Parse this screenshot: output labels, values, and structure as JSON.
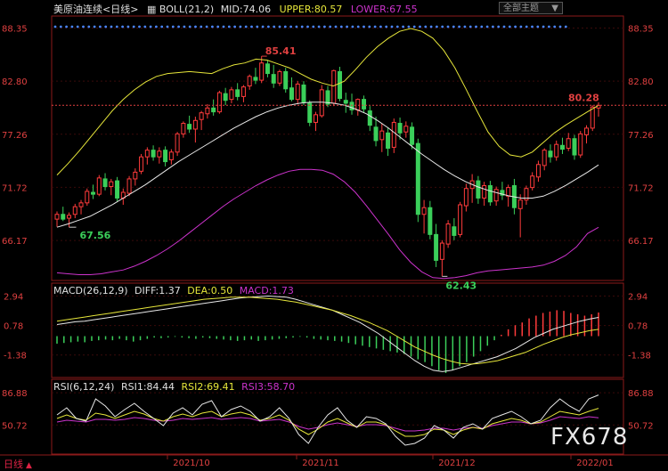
{
  "header": {
    "instrument": "美原油连续<日线>",
    "boll_name": "BOLL(21,2)",
    "mid": "MID:74.06",
    "upper": "UPPER:80.57",
    "lower": "LOWER:67.55",
    "theme_label": "全部主题",
    "theme_arrow": "▼"
  },
  "macd_header": {
    "name": "MACD(26,12,9)",
    "diff": "DIFF:1.37",
    "dea": "DEA:0.50",
    "macd": "MACD:1.73"
  },
  "rsi_header": {
    "name": "RSI(6,12,24)",
    "rsi1": "RSI1:84.44",
    "rsi2": "RSI2:69.41",
    "rsi3": "RSI3:58.70"
  },
  "period_tab": "日线",
  "watermark": "FX678",
  "chart_data": {
    "type": "candlestick",
    "price_axis_ticks": [
      "88.35",
      "82.80",
      "77.26",
      "71.72",
      "66.17"
    ],
    "macd_axis_ticks": [
      "2.94",
      "0.78",
      "-1.38"
    ],
    "rsi_axis_ticks": [
      "86.88",
      "50.72"
    ],
    "date_labels": [
      "2021/10",
      "2021/11",
      "2021/12",
      "2022/01"
    ],
    "annotations": {
      "high": "85.41",
      "low": "62.43",
      "start_low": "67.56",
      "last": "80.28"
    },
    "ylim": [
      62.0,
      89.6
    ],
    "last_price": 80.28,
    "candles": [
      [
        68.4,
        69.2,
        67.6,
        68.9
      ],
      [
        68.9,
        69.7,
        68.2,
        68.4
      ],
      [
        68.5,
        69.1,
        67.56,
        68.8
      ],
      [
        68.9,
        70.0,
        68.5,
        69.7
      ],
      [
        69.7,
        70.4,
        68.9,
        70.1
      ],
      [
        70.1,
        71.6,
        69.8,
        71.3
      ],
      [
        71.2,
        72.0,
        70.5,
        71.0
      ],
      [
        71.0,
        73.0,
        70.8,
        72.7
      ],
      [
        72.6,
        73.2,
        71.4,
        71.8
      ],
      [
        71.8,
        72.6,
        70.9,
        72.3
      ],
      [
        72.4,
        72.8,
        70.2,
        70.6
      ],
      [
        70.6,
        71.6,
        69.9,
        71.2
      ],
      [
        71.1,
        72.9,
        70.8,
        72.6
      ],
      [
        72.6,
        73.7,
        71.9,
        73.3
      ],
      [
        73.4,
        75.2,
        73.1,
        74.9
      ],
      [
        74.9,
        75.9,
        74.1,
        75.6
      ],
      [
        75.6,
        76.1,
        74.5,
        74.9
      ],
      [
        74.9,
        75.9,
        74.2,
        75.5
      ],
      [
        75.6,
        76.0,
        73.9,
        74.4
      ],
      [
        74.6,
        75.7,
        74.1,
        75.4
      ],
      [
        75.4,
        77.5,
        75.0,
        77.3
      ],
      [
        77.3,
        78.6,
        76.9,
        78.4
      ],
      [
        78.3,
        79.2,
        77.4,
        77.8
      ],
      [
        77.8,
        79.1,
        76.4,
        78.7
      ],
      [
        78.8,
        79.7,
        77.7,
        79.5
      ],
      [
        79.4,
        80.4,
        78.9,
        80.0
      ],
      [
        80.0,
        80.9,
        79.2,
        79.6
      ],
      [
        79.6,
        81.8,
        79.4,
        81.6
      ],
      [
        81.5,
        82.1,
        80.3,
        80.8
      ],
      [
        80.9,
        82.2,
        80.5,
        81.9
      ],
      [
        81.9,
        82.6,
        80.8,
        81.2
      ],
      [
        81.2,
        82.4,
        80.6,
        82.2
      ],
      [
        82.3,
        83.5,
        81.9,
        83.3
      ],
      [
        83.2,
        84.2,
        82.5,
        82.9
      ],
      [
        82.9,
        85.41,
        82.6,
        84.7
      ],
      [
        84.6,
        85.0,
        83.2,
        83.6
      ],
      [
        83.5,
        84.5,
        82.1,
        82.6
      ],
      [
        82.6,
        84.0,
        82.3,
        83.8
      ],
      [
        83.8,
        84.2,
        81.6,
        82.0
      ],
      [
        82.1,
        83.2,
        80.7,
        80.9
      ],
      [
        80.9,
        82.8,
        80.4,
        82.5
      ],
      [
        82.4,
        82.8,
        80.3,
        80.6
      ],
      [
        80.5,
        80.8,
        78.1,
        78.5
      ],
      [
        78.5,
        79.6,
        77.6,
        79.3
      ],
      [
        79.2,
        82.4,
        79.0,
        81.9
      ],
      [
        81.8,
        82.3,
        80.1,
        80.4
      ],
      [
        80.5,
        84.0,
        80.2,
        83.9
      ],
      [
        83.8,
        84.3,
        80.7,
        81.0
      ],
      [
        80.8,
        81.6,
        79.5,
        80.5
      ],
      [
        80.6,
        81.5,
        79.3,
        79.8
      ],
      [
        79.8,
        81.0,
        79.2,
        80.9
      ],
      [
        80.9,
        81.3,
        79.5,
        79.9
      ],
      [
        79.7,
        80.2,
        77.6,
        78.2
      ],
      [
        78.0,
        79.1,
        76.0,
        76.6
      ],
      [
        76.7,
        78.4,
        75.4,
        77.6
      ],
      [
        77.4,
        78.0,
        75.0,
        75.8
      ],
      [
        75.9,
        78.9,
        75.3,
        78.5
      ],
      [
        78.4,
        79.0,
        76.7,
        77.4
      ],
      [
        77.5,
        78.6,
        76.9,
        78.1
      ],
      [
        78.0,
        78.5,
        75.7,
        76.2
      ],
      [
        76.3,
        76.8,
        68.1,
        68.9
      ],
      [
        68.9,
        70.4,
        66.9,
        69.6
      ],
      [
        69.6,
        70.3,
        66.3,
        66.8
      ],
      [
        66.8,
        67.9,
        63.4,
        64.1
      ],
      [
        64.2,
        66.2,
        62.43,
        65.9
      ],
      [
        65.8,
        68.3,
        65.4,
        67.9
      ],
      [
        67.6,
        68.5,
        66.2,
        66.7
      ],
      [
        66.8,
        70.2,
        66.5,
        69.9
      ],
      [
        69.8,
        72.1,
        69.2,
        71.6
      ],
      [
        71.6,
        73.1,
        70.1,
        72.4
      ],
      [
        72.4,
        72.9,
        70.0,
        70.6
      ],
      [
        70.6,
        72.3,
        69.8,
        71.9
      ],
      [
        71.9,
        72.4,
        69.8,
        70.2
      ],
      [
        70.3,
        71.8,
        69.8,
        71.5
      ],
      [
        71.4,
        72.3,
        70.4,
        70.9
      ],
      [
        70.8,
        72.0,
        69.7,
        71.7
      ],
      [
        71.9,
        72.6,
        68.9,
        69.6
      ],
      [
        69.5,
        71.0,
        66.5,
        70.4
      ],
      [
        70.4,
        71.9,
        69.9,
        71.6
      ],
      [
        71.7,
        73.3,
        71.4,
        72.9
      ],
      [
        72.8,
        74.5,
        72.3,
        74.1
      ],
      [
        74.0,
        75.8,
        73.5,
        75.6
      ],
      [
        75.5,
        76.2,
        74.3,
        74.9
      ],
      [
        74.9,
        76.6,
        74.5,
        76.2
      ],
      [
        76.1,
        76.9,
        75.2,
        75.7
      ],
      [
        75.8,
        77.4,
        75.5,
        76.8
      ],
      [
        76.8,
        77.2,
        74.6,
        75.1
      ],
      [
        75.1,
        77.6,
        74.8,
        77.3
      ],
      [
        77.2,
        78.2,
        76.3,
        77.9
      ],
      [
        77.9,
        80.28,
        77.6,
        80.1
      ],
      [
        80.0,
        80.6,
        79.1,
        80.28
      ]
    ],
    "upper_band": [
      73.0,
      74.2,
      75.5,
      76.9,
      78.3,
      79.7,
      80.9,
      81.9,
      82.7,
      83.3,
      83.6,
      83.7,
      83.8,
      83.7,
      83.6,
      84.1,
      84.5,
      84.7,
      85.1,
      85.0,
      84.6,
      84.2,
      83.6,
      83.0,
      82.6,
      82.3,
      82.8,
      84.0,
      85.3,
      86.4,
      87.3,
      88.0,
      88.3,
      88.0,
      87.3,
      86.0,
      84.2,
      82.0,
      79.7,
      77.5,
      76.0,
      75.1,
      74.9,
      75.4,
      76.4,
      77.4,
      78.2,
      78.9,
      79.6,
      80.28
    ],
    "mid_band": [
      67.56,
      67.9,
      68.3,
      68.7,
      69.3,
      69.9,
      70.6,
      71.3,
      72.0,
      72.8,
      73.6,
      74.4,
      75.1,
      75.8,
      76.5,
      77.2,
      77.9,
      78.5,
      79.1,
      79.6,
      80.0,
      80.3,
      80.5,
      80.6,
      80.6,
      80.5,
      80.3,
      79.9,
      79.4,
      78.7,
      77.9,
      77.0,
      76.1,
      75.2,
      74.4,
      73.6,
      72.9,
      72.3,
      71.8,
      71.4,
      71.1,
      70.8,
      70.6,
      70.6,
      70.8,
      71.3,
      71.9,
      72.6,
      73.3,
      74.06
    ],
    "lower_band": [
      62.8,
      62.7,
      62.6,
      62.6,
      62.7,
      62.9,
      63.1,
      63.5,
      64.0,
      64.6,
      65.3,
      66.1,
      67.0,
      67.9,
      68.8,
      69.7,
      70.5,
      71.2,
      71.9,
      72.5,
      73.0,
      73.4,
      73.6,
      73.6,
      73.5,
      73.1,
      72.3,
      71.2,
      69.8,
      68.3,
      66.8,
      65.2,
      63.9,
      62.9,
      62.3,
      62.2,
      62.3,
      62.5,
      62.8,
      63.0,
      63.1,
      63.2,
      63.3,
      63.4,
      63.6,
      64.0,
      64.6,
      65.5,
      66.9,
      67.55
    ],
    "macd_hist": [
      -0.55,
      -0.5,
      -0.45,
      -0.4,
      -0.45,
      -0.35,
      -0.3,
      -0.25,
      -0.3,
      -0.2,
      -0.3,
      -0.4,
      -0.3,
      -0.2,
      -0.1,
      -0.15,
      -0.1,
      -0.05,
      -0.1,
      -0.15,
      -0.2,
      -0.1,
      -0.15,
      -0.2,
      -0.25,
      -0.3,
      -0.35,
      -0.3,
      -0.25,
      -0.35,
      -0.3,
      -0.25,
      -0.2,
      -0.15,
      -0.1,
      -0.05,
      -0.1,
      -0.2,
      -0.25,
      -0.3,
      -0.35,
      -0.4,
      -0.5,
      -0.6,
      -0.7,
      -0.8,
      -0.9,
      -1.0,
      -1.1,
      -1.2,
      -1.3,
      -1.5,
      -1.7,
      -1.9,
      -2.2,
      -2.5,
      -2.7,
      -2.5,
      -2.2,
      -1.9,
      -1.5,
      -1.1,
      -0.7,
      -0.3,
      0.1,
      0.5,
      0.8,
      1.0,
      1.3,
      1.5,
      1.7,
      1.8,
      1.9,
      1.85,
      1.7,
      1.6,
      1.5,
      1.6,
      1.73
    ],
    "macd_dif": [
      0.85,
      0.95,
      1.05,
      1.1,
      1.2,
      1.3,
      1.4,
      1.5,
      1.6,
      1.7,
      1.8,
      1.9,
      2.0,
      2.1,
      2.2,
      2.3,
      2.4,
      2.5,
      2.6,
      2.7,
      2.8,
      2.85,
      2.9,
      2.94,
      2.9,
      2.85,
      2.7,
      2.5,
      2.3,
      2.1,
      1.9,
      1.6,
      1.3,
      1.0,
      0.6,
      0.2,
      -0.3,
      -0.8,
      -1.3,
      -1.8,
      -2.2,
      -2.5,
      -2.6,
      -2.5,
      -2.3,
      -2.1,
      -1.9,
      -1.7,
      -1.5,
      -1.2,
      -0.9,
      -0.5,
      -0.1,
      0.2,
      0.5,
      0.7,
      0.9,
      1.1,
      1.25,
      1.37
    ],
    "macd_dea": [
      1.1,
      1.2,
      1.3,
      1.4,
      1.5,
      1.6,
      1.7,
      1.8,
      1.9,
      2.0,
      2.1,
      2.2,
      2.3,
      2.4,
      2.5,
      2.6,
      2.7,
      2.75,
      2.8,
      2.85,
      2.86,
      2.85,
      2.8,
      2.75,
      2.7,
      2.6,
      2.5,
      2.35,
      2.2,
      2.05,
      1.9,
      1.7,
      1.5,
      1.25,
      1.0,
      0.7,
      0.4,
      0.0,
      -0.4,
      -0.8,
      -1.1,
      -1.4,
      -1.65,
      -1.85,
      -2.0,
      -2.05,
      -2.0,
      -1.9,
      -1.8,
      -1.6,
      -1.4,
      -1.2,
      -0.9,
      -0.6,
      -0.35,
      -0.1,
      0.1,
      0.25,
      0.4,
      0.5
    ],
    "rsi1": [
      62,
      70,
      58,
      55,
      80,
      72,
      60,
      68,
      75,
      66,
      58,
      50,
      64,
      70,
      62,
      74,
      78,
      60,
      68,
      72,
      66,
      55,
      60,
      70,
      58,
      40,
      30,
      48,
      62,
      70,
      56,
      48,
      60,
      58,
      52,
      38,
      28,
      30,
      36,
      50,
      45,
      36,
      48,
      52,
      46,
      58,
      62,
      66,
      60,
      52,
      56,
      70,
      80,
      72,
      66,
      80,
      84.44
    ],
    "rsi2": [
      58,
      62,
      58,
      56,
      64,
      62,
      58,
      62,
      66,
      63,
      58,
      55,
      60,
      63,
      60,
      64,
      66,
      60,
      63,
      65,
      62,
      56,
      58,
      62,
      56,
      46,
      40,
      46,
      54,
      58,
      53,
      48,
      54,
      54,
      51,
      44,
      38,
      38,
      40,
      46,
      45,
      40,
      45,
      48,
      46,
      52,
      55,
      58,
      56,
      52,
      54,
      60,
      66,
      64,
      62,
      66,
      69.41
    ],
    "rsi3": [
      54,
      56,
      55,
      54,
      57,
      57,
      56,
      57,
      59,
      58,
      56,
      55,
      56,
      58,
      57,
      58,
      59,
      57,
      58,
      59,
      58,
      55,
      56,
      57,
      54,
      49,
      46,
      48,
      51,
      53,
      51,
      49,
      51,
      51,
      50,
      47,
      44,
      44,
      45,
      47,
      47,
      45,
      47,
      48,
      47,
      50,
      52,
      54,
      54,
      52,
      53,
      56,
      60,
      59,
      58,
      60,
      58.7
    ],
    "colors": {
      "up": "#ff3b3b",
      "down": "#3bcf5a",
      "mid": "#e8e8e8",
      "upper": "#e6e63a",
      "lower": "#cc33cc",
      "rsi1": "#e8e8e8",
      "rsi2": "#e6e63a",
      "rsi3": "#cc33cc",
      "frame": "#8b1a1a",
      "grid": "#3a0a0a"
    }
  }
}
